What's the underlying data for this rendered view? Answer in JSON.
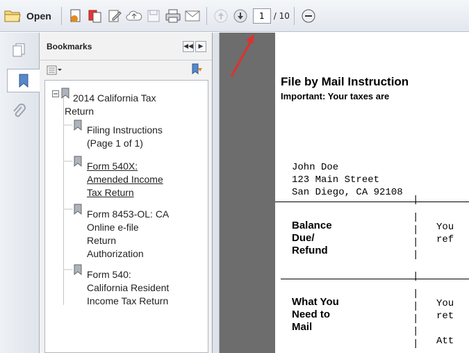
{
  "toolbar": {
    "open_label": "Open",
    "page_current": "1",
    "page_total": "/ 10"
  },
  "bookmarks_panel": {
    "title": "Bookmarks",
    "items": [
      {
        "label_lines": [
          "2014 California Tax",
          "Return"
        ]
      },
      {
        "label_lines": [
          "Filing Instructions",
          "(Page 1 of 1)"
        ]
      },
      {
        "label_lines": [
          "Form 540X:",
          "Amended Income",
          "Tax Return"
        ]
      },
      {
        "label_lines": [
          "Form 8453-OL: CA",
          "Online e-file",
          "Return",
          "Authorization"
        ]
      },
      {
        "label_lines": [
          "Form 540:",
          "California Resident",
          "Income Tax Return"
        ]
      }
    ]
  },
  "document": {
    "heading": "File by Mail Instruction",
    "subheading": "Important: Your taxes are",
    "address_lines": [
      "John Doe",
      "123 Main Street",
      "San Diego, CA 92108"
    ],
    "section1_label_lines": [
      "Balance",
      "Due/",
      "Refund"
    ],
    "section1_value_lines": [
      "You",
      "ref"
    ],
    "section2_label_lines": [
      "What You",
      "Need to",
      "Mail"
    ],
    "section2_value_lines": [
      "You",
      "ret",
      "Att"
    ]
  },
  "colors": {
    "annotation_arrow": "#e0302e",
    "doc_background": "#6d6d6d"
  }
}
